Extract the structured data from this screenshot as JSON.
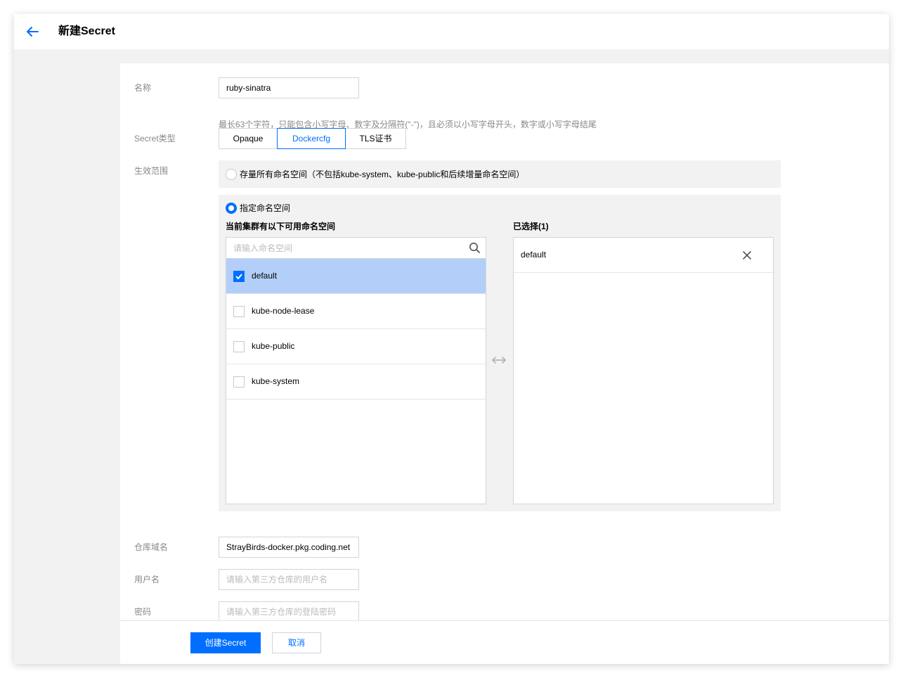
{
  "header": {
    "title": "新建Secret"
  },
  "form": {
    "name": {
      "label": "名称",
      "value": "ruby-sinatra",
      "hint": "最长63个字符，只能包含小写字母、数字及分隔符(\"-\")，且必须以小写字母开头，数字或小写字母结尾"
    },
    "secret_type": {
      "label": "Secret类型",
      "options": [
        "Opaque",
        "Dockercfg",
        "TLS证书"
      ],
      "selected": "Dockercfg"
    },
    "scope": {
      "label": "生效范围",
      "option_all": "存量所有命名空间（不包括kube-system、kube-public和后续增量命名空间）",
      "option_specific": "指定命名空间",
      "selected": "option_specific",
      "available_title": "当前集群有以下可用命名空间",
      "search_placeholder": "请输入命名空间",
      "namespaces": [
        {
          "name": "default",
          "checked": true
        },
        {
          "name": "kube-node-lease",
          "checked": false
        },
        {
          "name": "kube-public",
          "checked": false
        },
        {
          "name": "kube-system",
          "checked": false
        }
      ],
      "selected_title": "已选择(1)",
      "selected_items": [
        "default"
      ]
    },
    "registry": {
      "label": "仓库域名",
      "value": "StrayBirds-docker.pkg.coding.net"
    },
    "username": {
      "label": "用户名",
      "placeholder": "请输入第三方仓库的用户名"
    },
    "password": {
      "label": "密码",
      "placeholder": "请输入第三方仓库的登陆密码"
    }
  },
  "footer": {
    "submit_label": "创建Secret",
    "cancel_label": "取消"
  },
  "colors": {
    "accent": "#006eff",
    "selected_row": "#b3cff9",
    "background": "#f2f2f2"
  }
}
